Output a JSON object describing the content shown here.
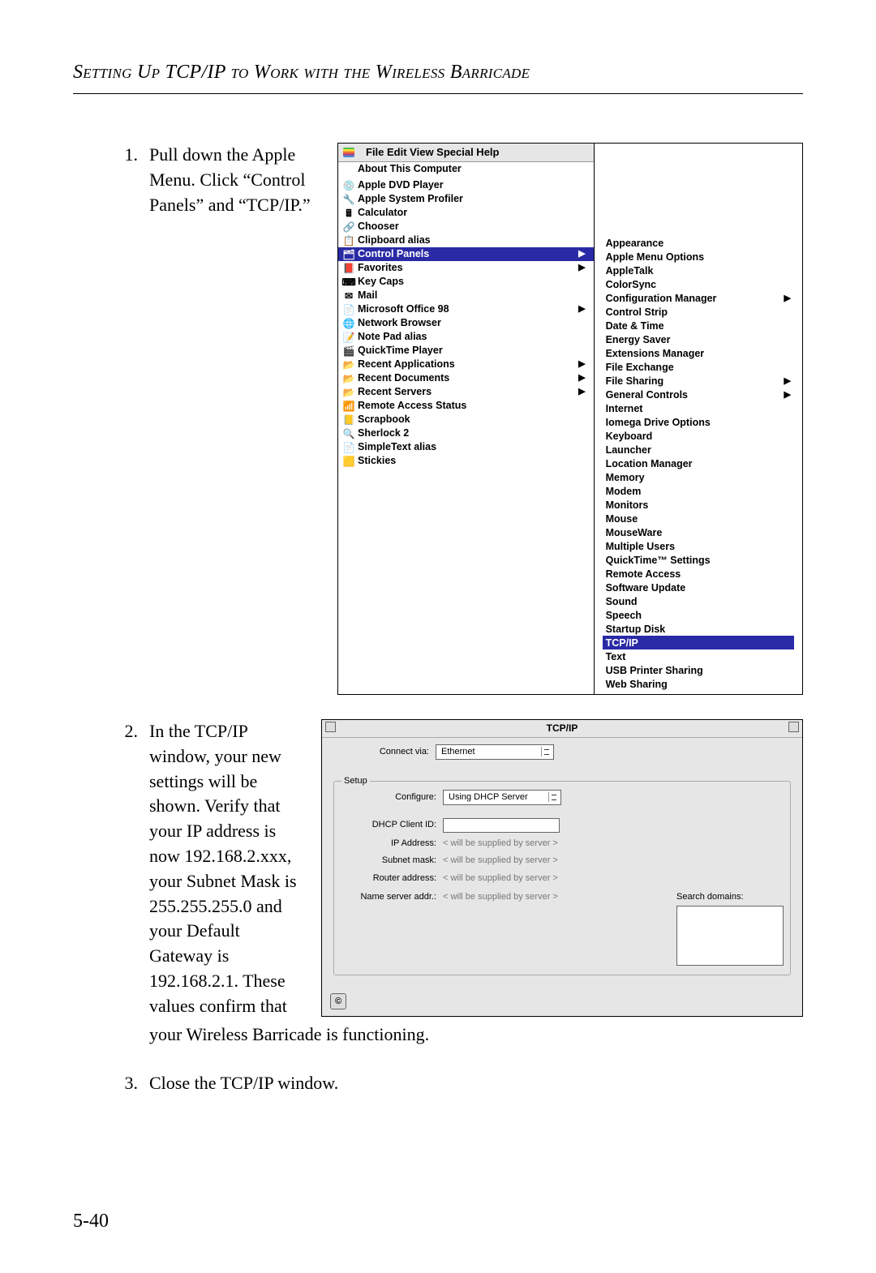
{
  "header": "Setting Up TCP/IP to Work with the Wireless Barricade",
  "page_number": "5-40",
  "steps": {
    "s1": {
      "num": "1.",
      "text": "Pull down the Apple Menu. Click “Control Panels” and “TCP/IP.”"
    },
    "s2": {
      "num": "2.",
      "text_narrow": "In the TCP/IP window, your new settings will be shown. Verify that your IP address is now 192.168.2.xxx, your Subnet Mask is 255.255.255.0 and your Default Gateway is 192.168.2.1. These values confirm that",
      "text_tail": "your Wireless Barricade is functioning."
    },
    "s3": {
      "num": "3.",
      "text": "Close the TCP/IP window."
    }
  },
  "apple_menu": {
    "menubar": [
      "File",
      "Edit",
      "View",
      "Special",
      "Help"
    ],
    "top": "About This Computer",
    "items": [
      {
        "icon": "💿",
        "label": "Apple DVD Player"
      },
      {
        "icon": "🔧",
        "label": "Apple System Profiler"
      },
      {
        "icon": "🖩",
        "label": "Calculator"
      },
      {
        "icon": "🔗",
        "label": "Chooser"
      },
      {
        "icon": "📋",
        "label": "Clipboard alias"
      },
      {
        "icon": "🗂",
        "label": "Control Panels",
        "arrow": true,
        "sel": true
      },
      {
        "icon": "📕",
        "label": "Favorites",
        "arrow": true
      },
      {
        "icon": "⌨",
        "label": "Key Caps"
      },
      {
        "icon": "✉",
        "label": "Mail"
      },
      {
        "icon": "📄",
        "label": "Microsoft Office 98",
        "arrow": true
      },
      {
        "icon": "🌐",
        "label": "Network Browser"
      },
      {
        "icon": "📝",
        "label": "Note Pad alias"
      },
      {
        "icon": "🎬",
        "label": "QuickTime Player"
      },
      {
        "icon": "📂",
        "label": "Recent Applications",
        "arrow": true
      },
      {
        "icon": "📂",
        "label": "Recent Documents",
        "arrow": true
      },
      {
        "icon": "📂",
        "label": "Recent Servers",
        "arrow": true
      },
      {
        "icon": "📶",
        "label": "Remote Access Status"
      },
      {
        "icon": "📒",
        "label": "Scrapbook"
      },
      {
        "icon": "🔍",
        "label": "Sherlock 2"
      },
      {
        "icon": "📄",
        "label": "SimpleText alias"
      },
      {
        "icon": "🟨",
        "label": "Stickies"
      }
    ],
    "submenu": [
      {
        "label": "Appearance"
      },
      {
        "label": "Apple Menu Options"
      },
      {
        "label": "AppleTalk"
      },
      {
        "label": "ColorSync"
      },
      {
        "label": "Configuration Manager",
        "arrow": true
      },
      {
        "label": "Control Strip"
      },
      {
        "label": "Date & Time"
      },
      {
        "label": "Energy Saver"
      },
      {
        "label": "Extensions Manager"
      },
      {
        "label": "File Exchange"
      },
      {
        "label": "File Sharing",
        "arrow": true
      },
      {
        "label": "General Controls",
        "arrow": true
      },
      {
        "label": "Internet"
      },
      {
        "label": "Iomega Drive Options"
      },
      {
        "label": "Keyboard"
      },
      {
        "label": "Launcher"
      },
      {
        "label": "Location Manager"
      },
      {
        "label": "Memory"
      },
      {
        "label": "Modem"
      },
      {
        "label": "Monitors"
      },
      {
        "label": "Mouse"
      },
      {
        "label": "MouseWare"
      },
      {
        "label": "Multiple Users"
      },
      {
        "label": "QuickTime™ Settings"
      },
      {
        "label": "Remote Access"
      },
      {
        "label": "Software Update"
      },
      {
        "label": "Sound"
      },
      {
        "label": "Speech"
      },
      {
        "label": "Startup Disk"
      },
      {
        "label": "TCP/IP",
        "sel": true
      },
      {
        "label": "Text"
      },
      {
        "label": "USB Printer Sharing"
      },
      {
        "label": "Web Sharing"
      }
    ]
  },
  "tcpip": {
    "title": "TCP/IP",
    "connect_via_label": "Connect via:",
    "connect_via_value": "Ethernet",
    "setup_label": "Setup",
    "configure_label": "Configure:",
    "configure_value": "Using DHCP Server",
    "dhcp_client_label": "DHCP Client ID:",
    "dhcp_client_value": "",
    "ip_label": "IP Address:",
    "subnet_label": "Subnet mask:",
    "router_label": "Router address:",
    "nameserver_label": "Name server addr.:",
    "supplied": "< will be supplied by server >",
    "search_domains_label": "Search domains:",
    "help_glyph": "©"
  }
}
